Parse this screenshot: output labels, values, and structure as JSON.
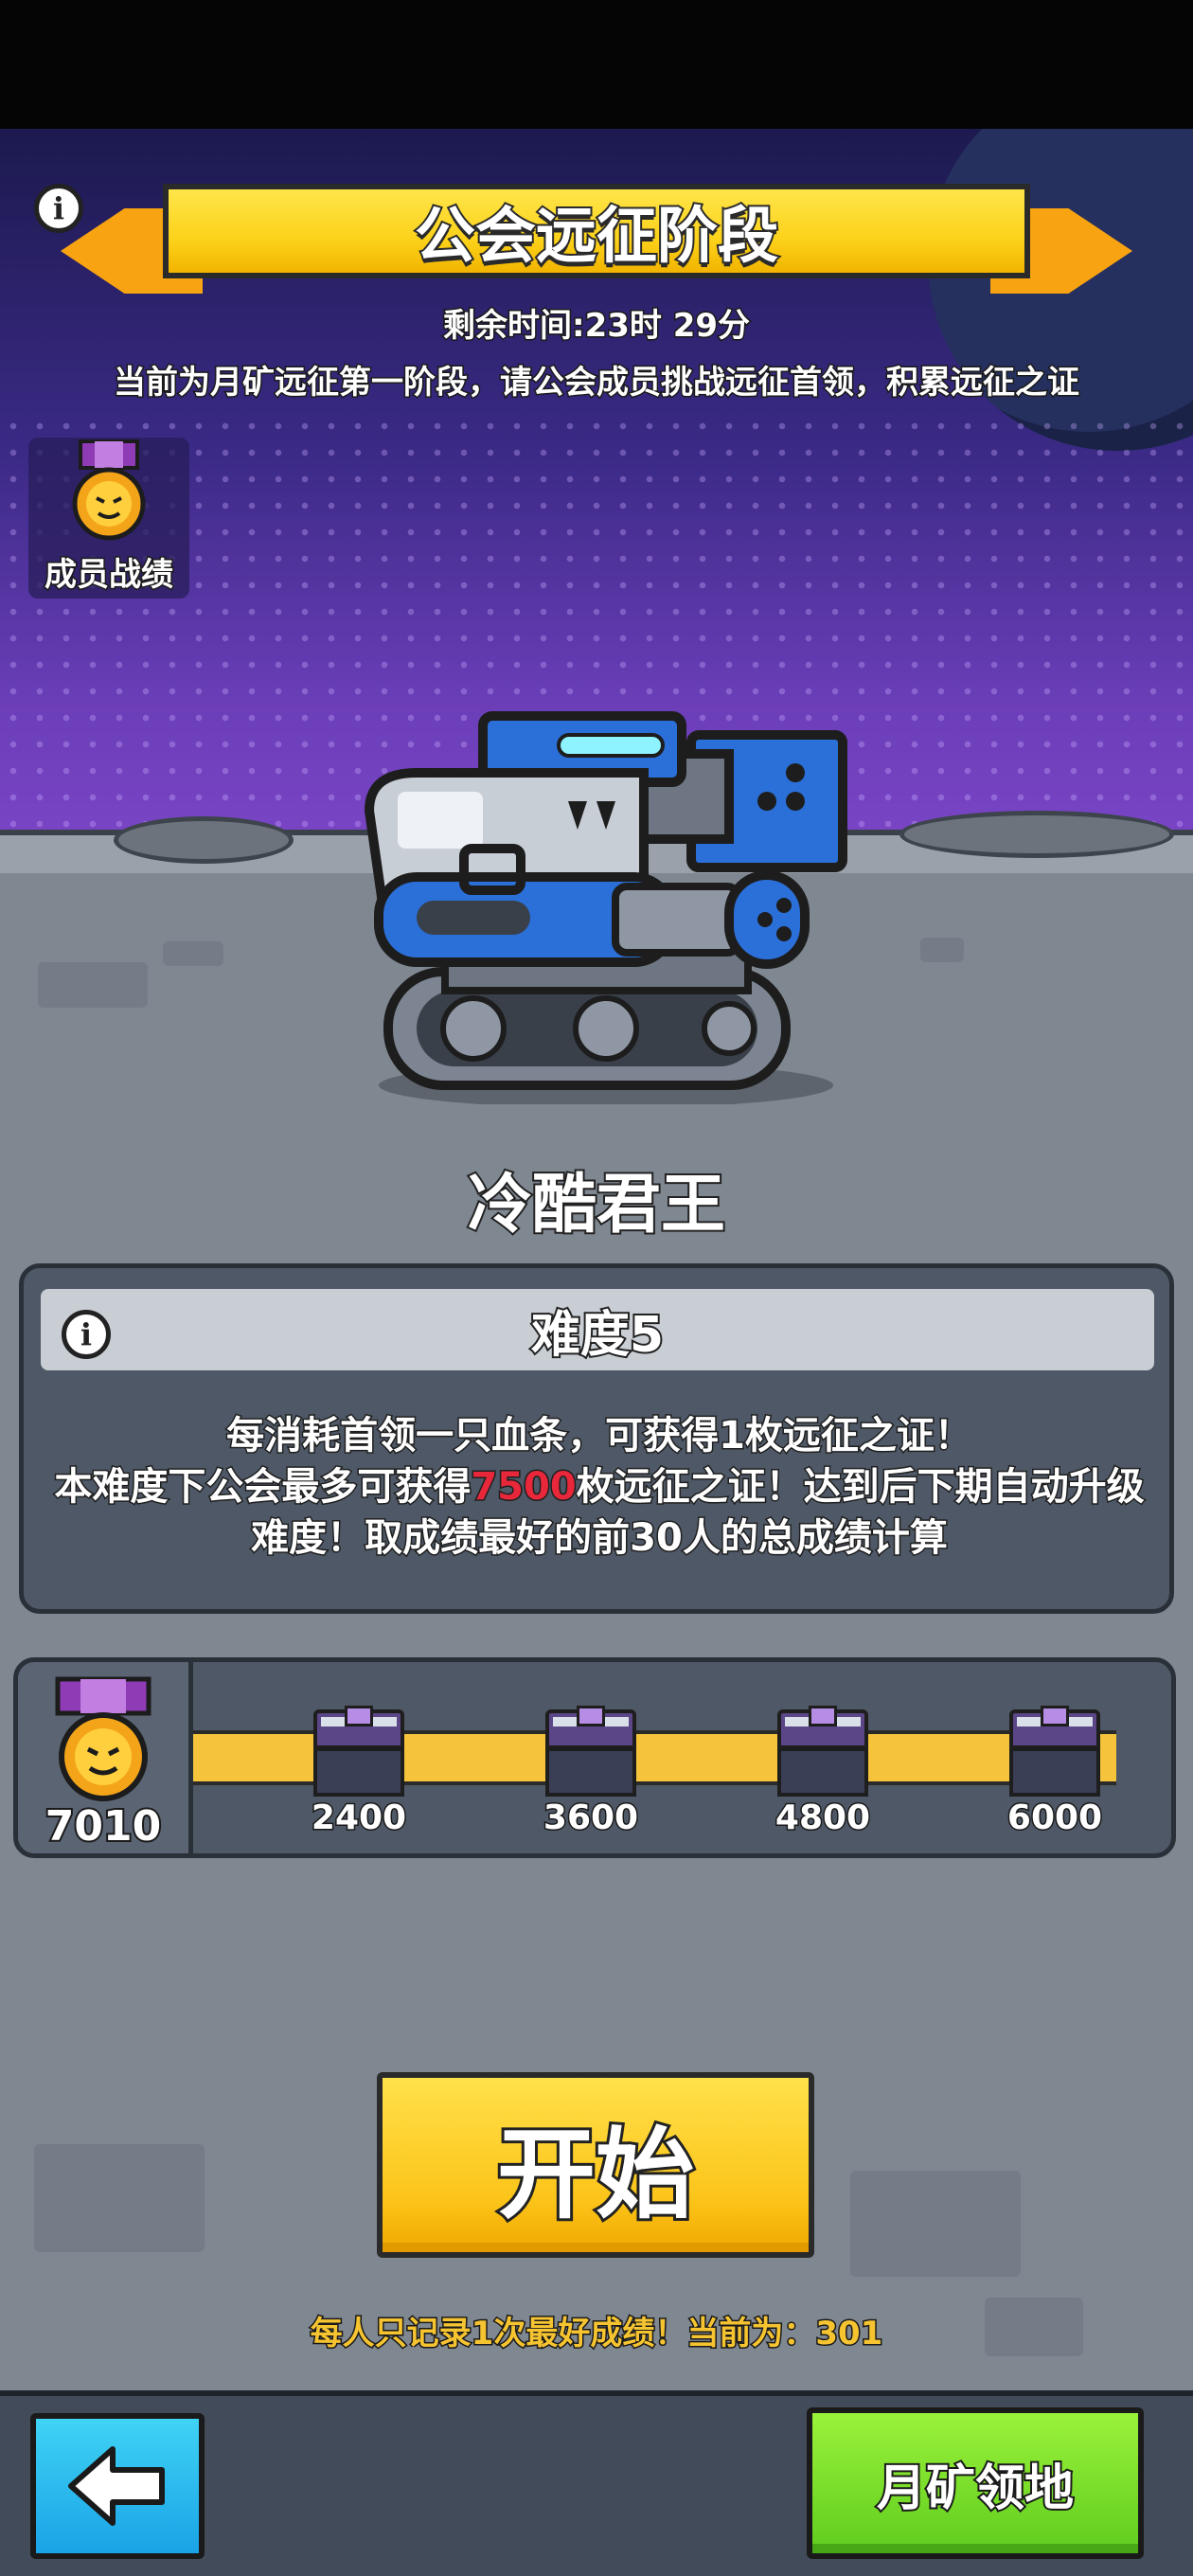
{
  "header": {
    "title": "公会远征阶段",
    "remaining_time": "剩余时间:23时 29分",
    "description": "当前为月矿远征第一阶段，请公会成员挑战远征首领，积累远征之证"
  },
  "member_record": {
    "label": "成员战绩"
  },
  "boss": {
    "name": "冷酷君王"
  },
  "difficulty": {
    "title": "难度5",
    "rule_line1": "每消耗首领一只血条，可获得1枚远征之证！",
    "rule_line2_prefix": "本难度下公会最多可获得",
    "rule_line2_highlight": "7500",
    "rule_line2_suffix": "枚远征之证！达到后下期自动升级难度！取成绩最好的前30人的总成绩计算"
  },
  "progress": {
    "current": "7010",
    "milestones": [
      "2400",
      "3600",
      "4800",
      "6000"
    ]
  },
  "actions": {
    "start_label": "开始",
    "note": "每人只记录1次最好成绩！当前为：301",
    "moon_territory_label": "月矿领地"
  },
  "colors": {
    "accent_yellow": "#fcd21a",
    "highlight_red": "#e8273b",
    "back_blue": "#1aa3e6",
    "green": "#5fcc1e"
  },
  "icons": {
    "info": "info-icon",
    "medal": "medal-icon",
    "chest": "chest-icon",
    "back": "back-arrow-icon"
  }
}
